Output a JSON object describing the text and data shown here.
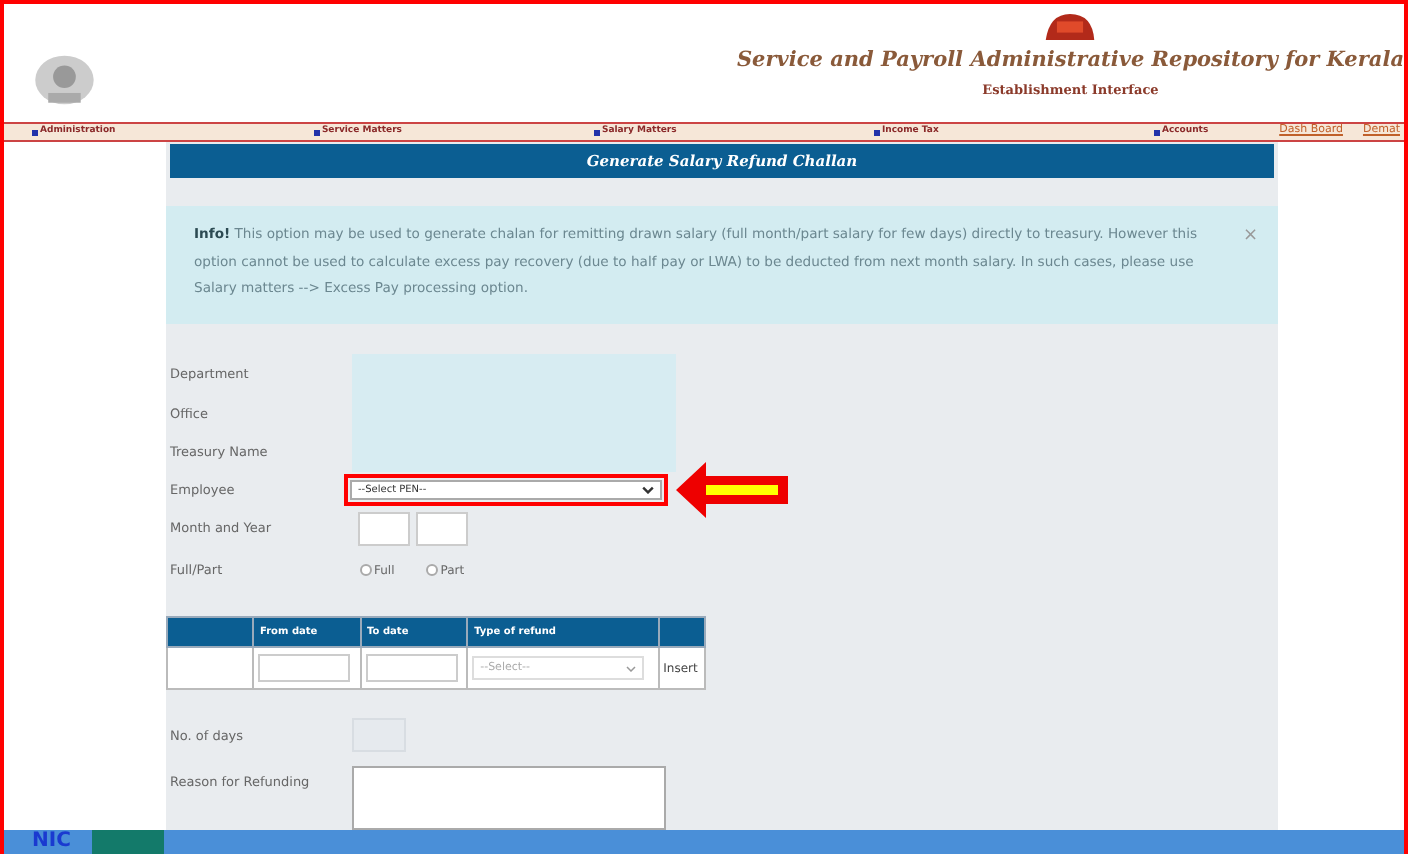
{
  "header": {
    "title": "Service and Payroll Administrative Repository for Kerala",
    "subtitle": "Establishment Interface",
    "links": [
      "Dash Board",
      "Demat"
    ]
  },
  "menu": [
    "Administration",
    "Service Matters",
    "Salary Matters",
    "Income Tax",
    "Accounts"
  ],
  "page_title": "Generate Salary Refund Challan",
  "info": {
    "text": "**Info!** This option may be used to generate chalan for remitting drawn salary (full month/part salary for few days) directly to treasury. However this option cannot be used to calculate excess pay recovery (due to half pay or LWA) to be deducted from next month salary. In such cases, please use Salary matters --> Excess Pay processing option.",
    "close": "×"
  },
  "form": {
    "info_labels": [
      "Department",
      "Office",
      "Treasury Name"
    ],
    "employee": {
      "label": "Employee",
      "value": "--Select PEN--",
      "highlighted": true
    },
    "month_year": {
      "label": "Month and Year"
    },
    "full_part": {
      "label": "Full/Part",
      "options": [
        {
          "label": "Full",
          "selected": false
        },
        {
          "label": "Part",
          "selected": false
        }
      ]
    },
    "table": {
      "columns": [
        "From date",
        "To date",
        "Type of refund"
      ],
      "type_value": "--Select--",
      "insert": "Insert"
    },
    "days": {
      "label": "No. of days"
    },
    "reason": {
      "label": "Reason for Refunding"
    }
  },
  "footer": {
    "logo": "NIC"
  }
}
